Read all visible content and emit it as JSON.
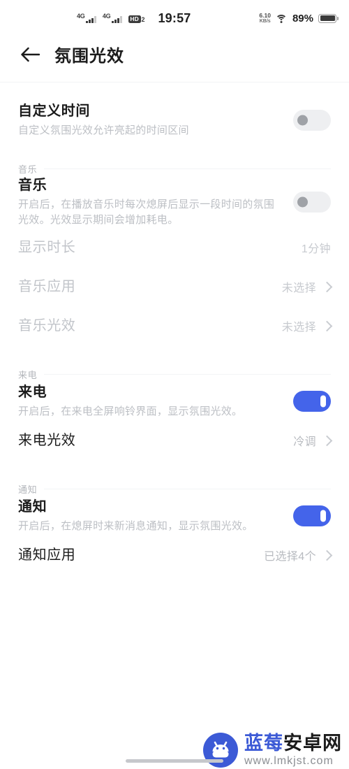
{
  "status_bar": {
    "sim1_network": "4G",
    "sim2_network": "4G",
    "volte_badge": "HD",
    "volte_sub": "2",
    "time": "19:57",
    "net_speed_value": "6.10",
    "net_speed_unit": "KB/s",
    "battery_percent": "89%"
  },
  "header": {
    "title": "氛围光效",
    "back_icon": "arrow-left-icon"
  },
  "sections": [
    {
      "label": null,
      "rows": [
        {
          "title": "自定义时间",
          "desc": "自定义氛围光效允许亮起的时间区间",
          "control": "toggle",
          "toggle_on": false
        }
      ]
    },
    {
      "label": "音乐",
      "rows": [
        {
          "title": "音乐",
          "desc": "开启后，在播放音乐时每次熄屏后显示一段时间的氛围光效。光效显示期间会增加耗电。",
          "control": "toggle",
          "toggle_on": false
        },
        {
          "title": "显示时长",
          "value": "1分钟",
          "control": "value",
          "disabled": true
        },
        {
          "title": "音乐应用",
          "value": "未选择",
          "control": "chevron",
          "disabled": true
        },
        {
          "title": "音乐光效",
          "value": "未选择",
          "control": "chevron",
          "disabled": true
        }
      ]
    },
    {
      "label": "来电",
      "rows": [
        {
          "title": "来电",
          "desc": "开启后，在来电全屏响铃界面，显示氛围光效。",
          "control": "toggle",
          "toggle_on": true
        },
        {
          "title": "来电光效",
          "value": "冷调",
          "control": "chevron",
          "disabled": false
        }
      ]
    },
    {
      "label": "通知",
      "rows": [
        {
          "title": "通知",
          "desc": "开启后，在熄屏时来新消息通知，显示氛围光效。",
          "control": "toggle",
          "toggle_on": true
        },
        {
          "title": "通知应用",
          "value": "已选择4个",
          "control": "chevron",
          "disabled": false
        }
      ]
    }
  ],
  "watermark": {
    "brand_part1": "蓝莓",
    "brand_part2": "安卓网",
    "url": "www.lmkjst.com",
    "logo_icon": "android-robot-icon",
    "logo_color": "#3c5ad6"
  },
  "colors": {
    "toggle_on": "#4464ea",
    "toggle_off_track": "#eeeff1",
    "title": "#1b1b1b",
    "desc": "#bcbfc4",
    "disabled": "#c2c5ca"
  }
}
